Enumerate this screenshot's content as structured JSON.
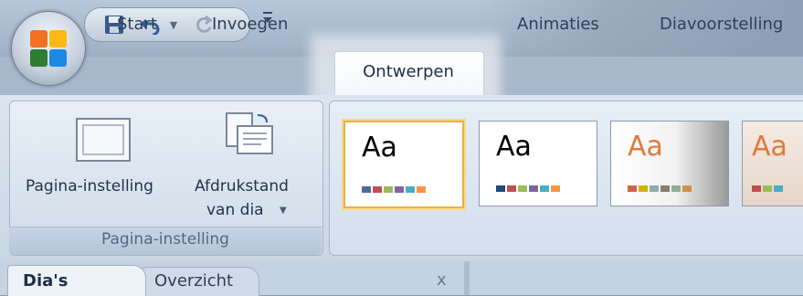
{
  "qat": {
    "save_icon": "save-icon",
    "undo_icon": "undo-icon",
    "redo_icon": "redo-icon",
    "customize_icon": "customize-qat-icon"
  },
  "tabs": [
    {
      "label": "Start"
    },
    {
      "label": "Invoegen"
    },
    {
      "label": "Ontwerpen",
      "active": true
    },
    {
      "label": "Animaties"
    },
    {
      "label": "Diavoorstelling"
    }
  ],
  "ribbon": {
    "group1": {
      "label": "Pagina-instelling",
      "buttons": [
        {
          "label": "Pagina-instelling",
          "icon": "page-setup-icon"
        },
        {
          "label_line1": "Afdrukstand",
          "label_line2": "van dia",
          "icon": "slide-orientation-icon",
          "dropdown_icon": "chevron-down-icon"
        }
      ]
    },
    "themes": [
      {
        "text": "Aa",
        "text_color": "#000000",
        "swatches": [
          "#4f6a92",
          "#c0504d",
          "#9bbb59",
          "#8064a2",
          "#4bacc6",
          "#f79646"
        ]
      },
      {
        "text": "Aa",
        "text_color": "#000000",
        "swatches": [
          "#1f497d",
          "#c0504d",
          "#9bbb59",
          "#8064a2",
          "#4bacc6",
          "#f79646"
        ]
      },
      {
        "text": "Aa",
        "text_color": "#e07a3a",
        "swatches": [
          "#d16349",
          "#ccb400",
          "#8cadae",
          "#8c7b70",
          "#8fb08c",
          "#d19049"
        ]
      },
      {
        "text": "Aa",
        "text_color": "#e07a3a",
        "swatches": [
          "#c0504d",
          "#9bbb59",
          "#4bacc6"
        ]
      }
    ]
  },
  "panes": {
    "tab1": "Dia's",
    "tab2": "Overzicht",
    "close": "x"
  },
  "colors": {
    "accent_selected": "#e2b24a",
    "ribbon_bg": "#dbe5f0"
  }
}
